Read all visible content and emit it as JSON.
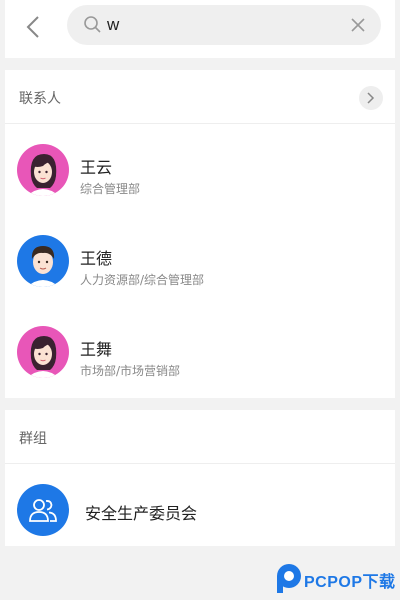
{
  "search": {
    "value": "w",
    "back_icon": "chevron-left-icon",
    "search_icon": "search-icon",
    "clear_icon": "close-icon"
  },
  "contacts_section": {
    "title": "联系人",
    "more_icon": "chevron-right-icon",
    "items": [
      {
        "name": "王云",
        "dept": "综合管理部",
        "avatar_color": "#e856b8"
      },
      {
        "name": "王德",
        "dept": "人力资源部/综合管理部",
        "avatar_color": "#1e78e6"
      },
      {
        "name": "王舞",
        "dept": "市场部/市场营销部",
        "avatar_color": "#e856b8"
      }
    ]
  },
  "groups_section": {
    "title": "群组",
    "items": [
      {
        "name": "安全生产委员会",
        "icon": "group-icon",
        "avatar_color": "#1e78e6"
      }
    ]
  },
  "watermark": {
    "text": "PCPOP下载"
  },
  "colors": {
    "accent": "#1e78e6",
    "pink": "#e856b8",
    "background": "#f2f2f2"
  }
}
